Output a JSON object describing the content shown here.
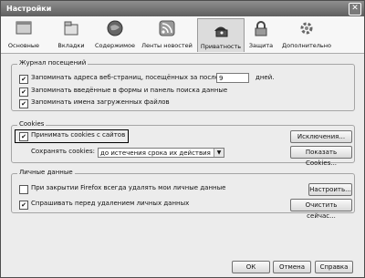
{
  "window": {
    "title": "Настройки"
  },
  "tabs": [
    {
      "label": "Основные",
      "icon": "general-icon"
    },
    {
      "label": "Вкладки",
      "icon": "tabs-icon"
    },
    {
      "label": "Содержимое",
      "icon": "content-icon"
    },
    {
      "label": "Ленты новостей",
      "icon": "feeds-icon"
    },
    {
      "label": "Приватность",
      "icon": "privacy-icon",
      "active": true
    },
    {
      "label": "Защита",
      "icon": "security-icon"
    },
    {
      "label": "Дополнительно",
      "icon": "advanced-icon"
    }
  ],
  "history": {
    "title": "Журнал посещений",
    "remember_visits_prefix": "Запоминать адреса веб-страниц, посещённых за последние",
    "days_value": "9",
    "days_suffix": "дней.",
    "remember_forms": "Запоминать введённые в формы и панель поиска данные",
    "remember_downloads": "Запоминать имена загруженных файлов"
  },
  "cookies": {
    "title": "Cookies",
    "accept": "Принимать cookies с сайтов",
    "exceptions_button": "Исключения...",
    "keep_label": "Сохранять cookies:",
    "keep_value": "до истечения срока их действия",
    "show_button": "Показать Cookies..."
  },
  "private": {
    "title": "Личные данные",
    "clear_on_close": "При закрытии Firefox всегда удалять мои личные данные",
    "settings_button": "Настроить...",
    "ask_before": "Спрашивать перед удалением личных данных",
    "clear_now_button": "Очистить сейчас..."
  },
  "footer": {
    "ok": "ОК",
    "cancel": "Отмена",
    "help": "Справка"
  }
}
